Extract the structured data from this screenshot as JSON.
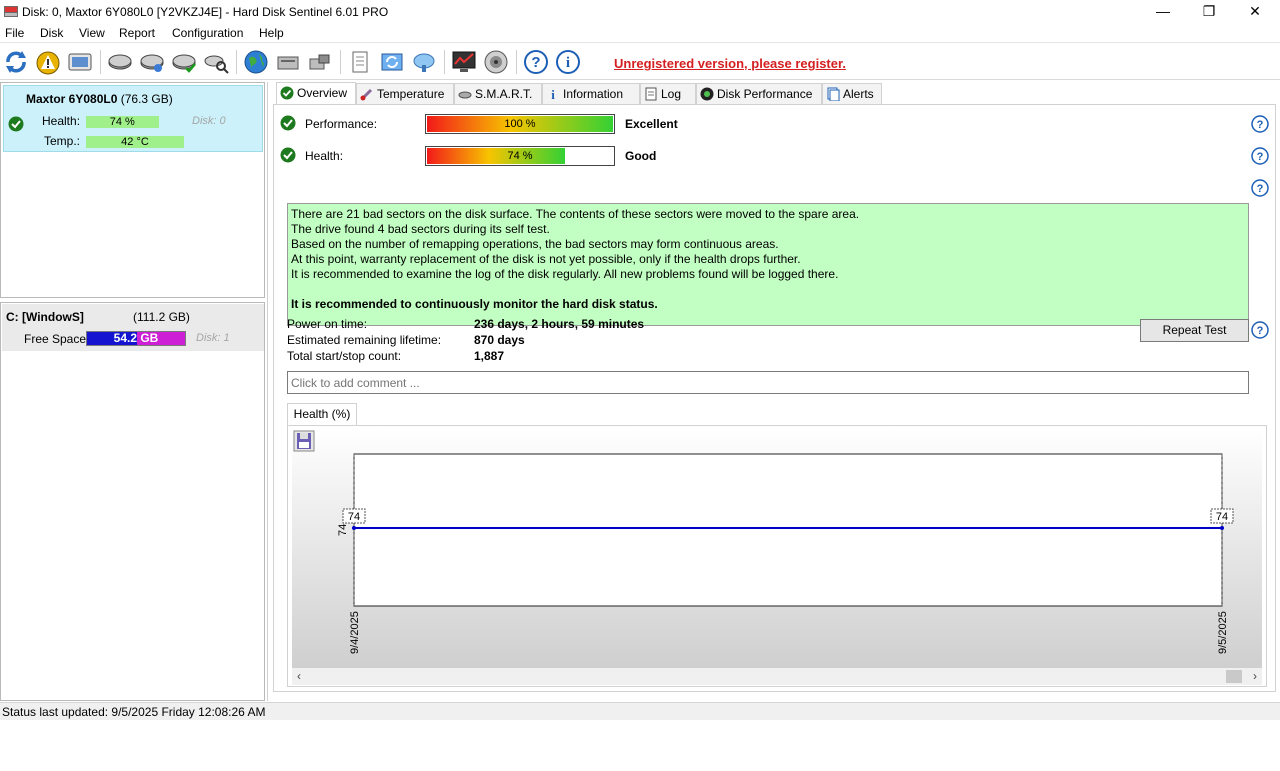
{
  "window": {
    "title": "Disk: 0, Maxtor 6Y080L0 [Y2VKZJ4E]  -  Hard Disk Sentinel 6.01 PRO",
    "minimize": "—",
    "maximize": "❐",
    "close": "✕"
  },
  "menu": {
    "file": "File",
    "disk": "Disk",
    "view": "View",
    "report": "Report",
    "configuration": "Configuration",
    "help": "Help"
  },
  "toolbar": {
    "register_text": "Unregistered version, please register.",
    "icons": [
      "refresh-icon",
      "alert-icon",
      "disk-info-icon",
      "disk-test-icon",
      "disk-test-2-icon",
      "disk-check-icon",
      "disk-search-icon",
      "globe-icon",
      "server-icon",
      "network-disk-icon",
      "document-icon",
      "sync-icon",
      "cloud-icon",
      "monitor-chart-icon",
      "speaker-icon",
      "help-icon",
      "info-icon"
    ]
  },
  "disk": {
    "name": "Maxtor 6Y080L0",
    "size": "(76.3 GB)",
    "health_label": "Health:",
    "health_value": "74 %",
    "health_fraction": 0.74,
    "disk_label": "Disk: 0",
    "temp_label": "Temp.:",
    "temp_value": "42 °C"
  },
  "volume": {
    "name": "C: [WindowS]",
    "size": "(111.2 GB)",
    "free_label": "Free Space",
    "free_value": "54.2 GB",
    "used_fraction": 0.51,
    "disk_label": "Disk: 1"
  },
  "tabs": {
    "overview": "Overview",
    "temperature": "Temperature",
    "smart": "S.M.A.R.T.",
    "information": "Information",
    "log": "Log",
    "disk_performance": "Disk Performance",
    "alerts": "Alerts"
  },
  "overview": {
    "performance_label": "Performance:",
    "performance_value": "100 %",
    "performance_fraction": 1.0,
    "performance_rating": "Excellent",
    "health_label": "Health:",
    "health_value": "74 %",
    "health_fraction": 0.74,
    "health_rating": "Good",
    "message_lines": [
      "There are 21 bad sectors on the disk surface. The contents of these sectors were moved to the spare area.",
      "The drive found 4 bad sectors during its self test.",
      "Based on the number of remapping operations, the bad sectors may form continuous areas.",
      "At this point, warranty replacement of the disk is not yet possible, only if the health drops further.",
      "It is recommended to examine the log of the disk regularly. All new problems found will be logged there."
    ],
    "message_bold": "It is recommended to continuously monitor the hard disk status.",
    "power_on_label": "Power on time:",
    "power_on_value": "236 days, 2 hours, 59 minutes",
    "lifetime_label": "Estimated remaining lifetime:",
    "lifetime_value": "870 days",
    "startstop_label": "Total start/stop count:",
    "startstop_value": "1,887",
    "repeat_test": "Repeat Test",
    "comment_placeholder": "Click to add comment ..."
  },
  "chart_tab": "Health (%)",
  "chart_data": {
    "type": "line",
    "x": [
      "9/4/2025",
      "9/5/2025"
    ],
    "series": [
      {
        "values": [
          74,
          74
        ]
      }
    ],
    "data_labels": [
      "74",
      "74"
    ],
    "ytick": "74",
    "color": "#0000c8"
  },
  "status": {
    "text": "Status last updated: 9/5/2025 Friday 12:08:26 AM"
  }
}
